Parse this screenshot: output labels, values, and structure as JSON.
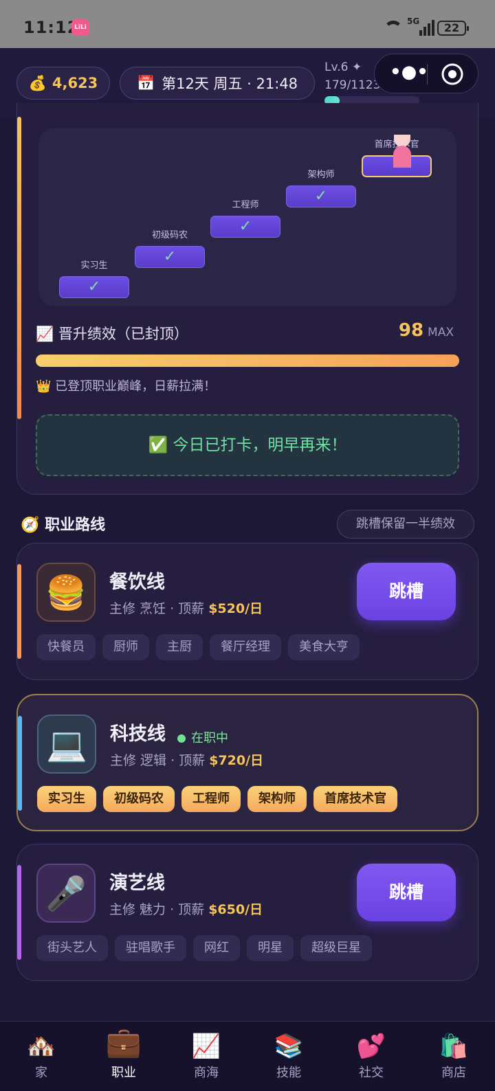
{
  "status_bar": {
    "time": "11:12",
    "app_badge": "LiLi",
    "network": "5G",
    "battery": "22"
  },
  "top_bar": {
    "coins": "4,623",
    "day_info": "第12天 周五 · 21:48",
    "level": "Lv.6",
    "level_star": "✦",
    "exp": "179/1123",
    "exp_progress": 0.159,
    "menu_glyph": "•●•"
  },
  "ladder": {
    "steps": [
      {
        "label": "实习生",
        "check": "✓"
      },
      {
        "label": "初级码农",
        "check": "✓"
      },
      {
        "label": "工程师",
        "check": "✓"
      },
      {
        "label": "架构师",
        "check": "✓"
      },
      {
        "label": "首席技术官",
        "check": ""
      }
    ]
  },
  "performance": {
    "icon": "📈",
    "title": "晋升绩效（已封顶）",
    "value": "98",
    "max_label": "MAX",
    "progress": 1.0,
    "note_icon": "👑",
    "note": "已登顶职业巅峰，日薪拉满！"
  },
  "checkin": {
    "icon": "✅",
    "text": "今日已打卡，明早再来！"
  },
  "routes": {
    "icon": "🧭",
    "title": "职业路线",
    "hint": "跳槽保留一半绩效",
    "careers": [
      {
        "icon": "🍔",
        "name": "餐饮线",
        "desc_prefix": "主修 烹饪 · 顶薪 ",
        "salary": "$520/日",
        "button": "跳槽",
        "status": "",
        "accent": "#f29a5b",
        "tags": [
          "快餐员",
          "厨师",
          "主厨",
          "餐厅经理",
          "美食大亨"
        ]
      },
      {
        "icon": "💻",
        "name": "科技线",
        "desc_prefix": "主修 逻辑 · 顶薪 ",
        "salary": "$720/日",
        "button": "",
        "status": "在职中",
        "accent": "#5ab8f2",
        "tags": [
          "实习生",
          "初级码农",
          "工程师",
          "架构师",
          "首席技术官"
        ]
      },
      {
        "icon": "🎤",
        "name": "演艺线",
        "desc_prefix": "主修 魅力 · 顶薪 ",
        "salary": "$650/日",
        "button": "跳槽",
        "status": "",
        "accent": "#b366e8",
        "tags": [
          "街头艺人",
          "驻唱歌手",
          "网红",
          "明星",
          "超级巨星"
        ]
      }
    ]
  },
  "nav": [
    {
      "icon": "🏘️",
      "label": "家",
      "active": false
    },
    {
      "icon": "💼",
      "label": "职业",
      "active": true
    },
    {
      "icon": "📈",
      "label": "商海",
      "active": false
    },
    {
      "icon": "📚",
      "label": "技能",
      "active": false
    },
    {
      "icon": "💕",
      "label": "社交",
      "active": false
    },
    {
      "icon": "🛍️",
      "label": "商店",
      "active": false
    }
  ]
}
